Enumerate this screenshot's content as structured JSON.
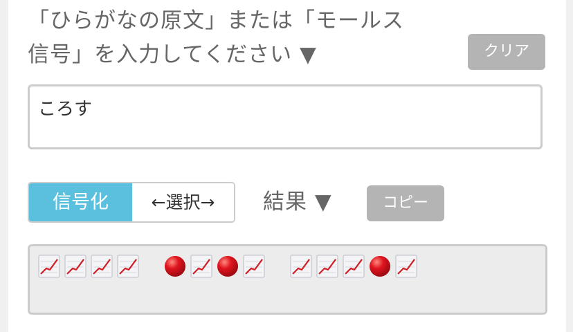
{
  "prompt": {
    "line1": "「ひらがなの原文」または「モールス",
    "line2": "信号」を入力してください ▼"
  },
  "clear_button": {
    "label": "クリア"
  },
  "input": {
    "value": "ころす"
  },
  "mode_toggle": {
    "encode_label": "信号化",
    "select_label": "←選択→"
  },
  "result": {
    "label": "結果 ▼",
    "copy_label": "コピー"
  },
  "output": {
    "groups": [
      [
        "dash",
        "dash",
        "dash",
        "dash"
      ],
      [
        "dot",
        "dash",
        "dot",
        "dash"
      ],
      [
        "dash",
        "dash",
        "dash",
        "dot",
        "dash"
      ]
    ]
  },
  "colors": {
    "accent": "#5bc0de",
    "button_gray": "#b4b4b4",
    "dot_red": "#e0141e"
  }
}
